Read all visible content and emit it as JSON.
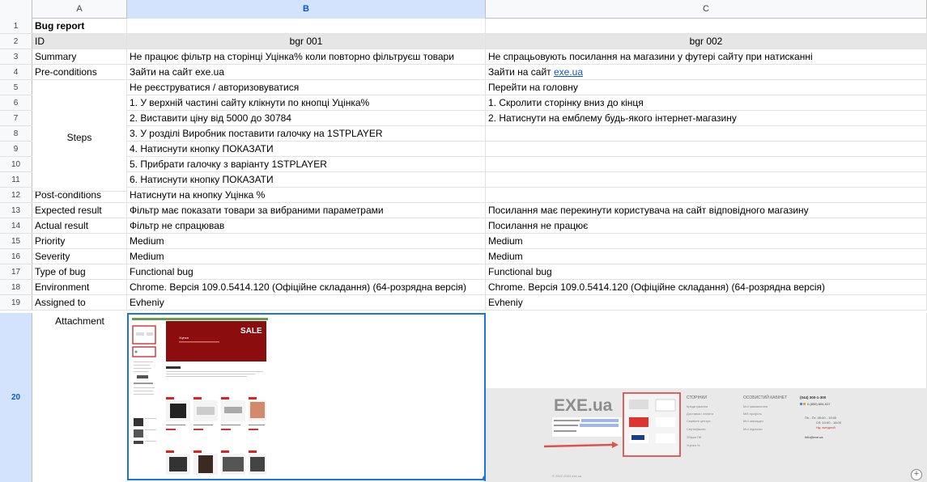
{
  "columns": [
    "A",
    "B",
    "C"
  ],
  "rows": [
    {
      "n": "1",
      "a": "Bug report",
      "b": "",
      "c": ""
    },
    {
      "n": "2",
      "a": "ID",
      "b": "bgr 001",
      "c": "bgr 002"
    },
    {
      "n": "3",
      "a": "Summary",
      "b": "Не працює фільтр на сторінці Уцінка% коли повторно фільтруєш товари",
      "c": "Не спрацьовують посилання на  магазини у футері сайту при натисканні"
    },
    {
      "n": "4",
      "a": "Pre-conditions",
      "b": "Зайти на сайт exe.ua",
      "c_prefix": "Зайти на сайт ",
      "c_link": "exe.ua"
    },
    {
      "n": "5",
      "a": "",
      "b": "Не реєструватися / авторизовуватися",
      "c": "Перейти на головну"
    },
    {
      "n": "6",
      "a": "",
      "b": "1. У верхній частині сайту клікнути по кнопці Уцінка%",
      "c": "1. Скролити сторінку вниз до кінця"
    },
    {
      "n": "7",
      "a": "",
      "b": "2. Виставити ціну від 5000 до 30784",
      "c": "2. Натиснути на емблему будь-якого інтернет-магазину"
    },
    {
      "n": "8",
      "a": "",
      "b": "3. У розділі Виробник поставити галочку на 1STPLAYER",
      "c": ""
    },
    {
      "n": "9",
      "a": "",
      "b": "4. Натиснути кнопку ПОКАЗАТИ",
      "c": ""
    },
    {
      "n": "10",
      "a": "",
      "b": "5. Прибрати галочку з варіанту 1STPLAYER",
      "c": ""
    },
    {
      "n": "11",
      "a": "",
      "b": "6. Натиснути кнопку ПОКАЗАТИ",
      "c": ""
    },
    {
      "n": "12",
      "a": "Post-conditions",
      "b": "Натиснути на кнопку Уцінка %",
      "c": ""
    },
    {
      "n": "13",
      "a": "Expected result",
      "b": "Фільтр має показати товари за вибраними параметрами",
      "c": "Посилання має перекинути користувача на сайт відповідного магазину"
    },
    {
      "n": "14",
      "a": "Actual result",
      "b": "Фільтр не спрацював",
      "c": "Посилання не працює"
    },
    {
      "n": "15",
      "a": "Priority",
      "b": "Medium",
      "c": "Medium"
    },
    {
      "n": "16",
      "a": "Severity",
      "b": "Medium",
      "c": "Medium"
    },
    {
      "n": "17",
      "a": "Type of bug",
      "b": "Functional bug",
      "c": "Functional bug"
    },
    {
      "n": "18",
      "a": "Environment",
      "b": "Chrome. Версія 109.0.5414.120 (Офіційне складання) (64-розрядна версія)",
      "c": "Chrome. Версія 109.0.5414.120 (Офіційне складання) (64-розрядна версія)"
    },
    {
      "n": "19",
      "a": "Assigned to",
      "b": "Evheniy",
      "c": "Evheniy"
    }
  ],
  "steps_label": "Steps",
  "row20": {
    "n": "20",
    "a": "Attachment"
  },
  "screenshot_b": {
    "sale_text": "SALE",
    "banner_title": "Уцінка"
  },
  "screenshot_c": {
    "logo": "EXE.ua",
    "col1_title": "СТОРІНКИ",
    "col1_items": [
      "Кредитування",
      "Доставка і оплата",
      "Сервісні центри",
      "Сертифікати",
      "Збірка ПК",
      "Уцінка %"
    ],
    "col2_title": "ОСОБИСТИЙ КАБІНЕТ",
    "col2_items": [
      "Мої замовлення",
      "Мій профіль",
      "Мої закладки",
      "Мої підписки"
    ],
    "phone1": "(044) 300-1-300",
    "phone2": "0 (800) 604-517",
    "hours1": "Пн - Пт: 09:00 - 19:00",
    "hours2": "Сб: 10:00 - 18:00",
    "hours3": "Нд: вихідний",
    "email": "info@exe.ua",
    "copyright": "© 2007-2023 exe.ua"
  },
  "colors": {
    "selection": "#1a73e8",
    "header_bg": "#f8f9fa",
    "gray_row": "#e6e6e6",
    "link": "#1155cc",
    "sale_red": "#8b0d0d"
  }
}
